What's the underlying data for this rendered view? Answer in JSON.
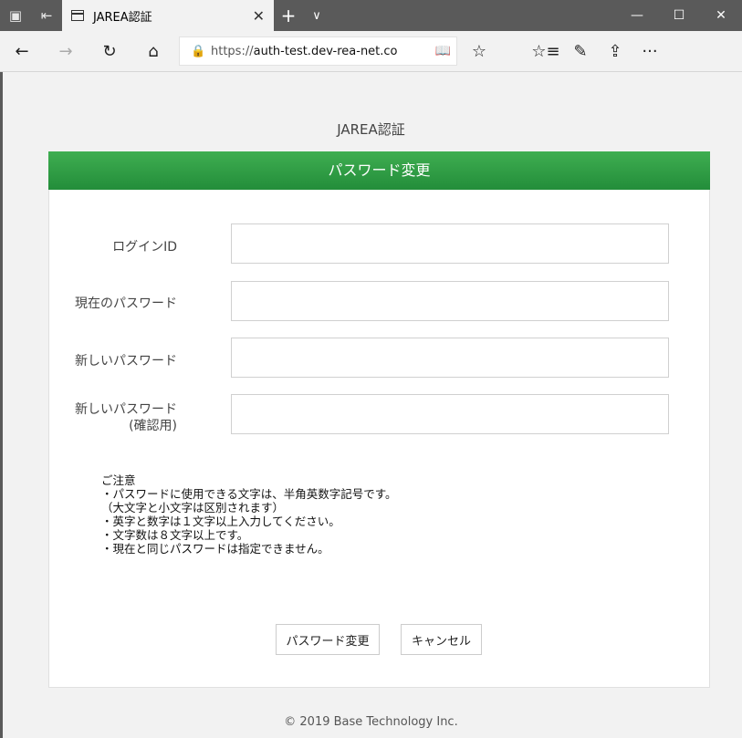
{
  "browser": {
    "tab_title": "JAREA認証",
    "url_scheme": "https://",
    "url_host": "auth-test.dev-rea-net.co"
  },
  "page": {
    "site_title": "JAREA認証",
    "form_title": "パスワード変更",
    "fields": [
      {
        "label": "ログインID",
        "value": ""
      },
      {
        "label": "現在のパスワード",
        "value": ""
      },
      {
        "label": "新しいパスワード",
        "value": ""
      },
      {
        "label": "新しいパスワード",
        "label2": "(確認用)",
        "value": ""
      }
    ],
    "notes": [
      "ご注意",
      "・パスワードに使用できる文字は、半角英数字記号です。",
      "（大文字と小文字は区別されます）",
      "・英字と数字は１文字以上入力してください。",
      "・文字数は８文字以上です。",
      "・現在と同じパスワードは指定できません。"
    ],
    "submit_label": "パスワード変更",
    "cancel_label": "キャンセル",
    "footer": "© 2019 Base Technology Inc."
  },
  "colors": {
    "header_green": "#2e9e44",
    "chrome_dark": "#5a5a5a"
  }
}
